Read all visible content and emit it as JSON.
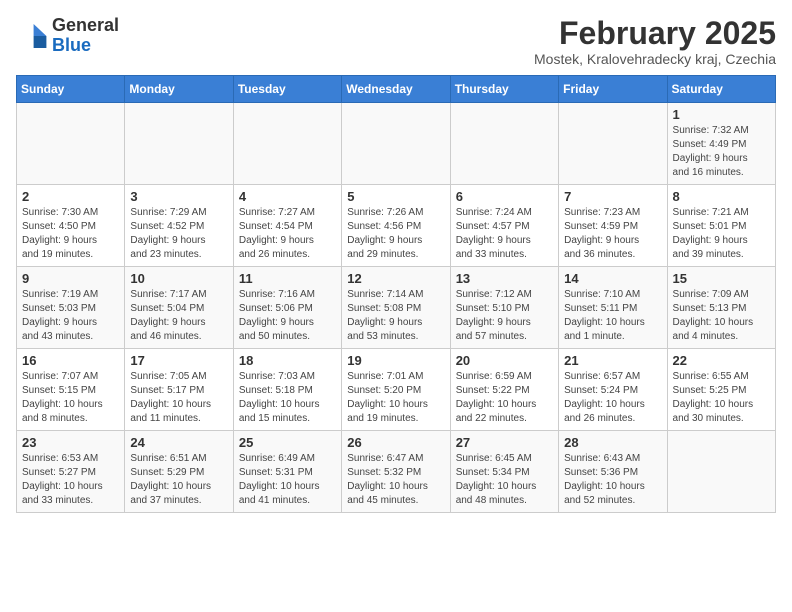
{
  "header": {
    "logo_line1": "General",
    "logo_line2": "Blue",
    "month_year": "February 2025",
    "location": "Mostek, Kralovehradecky kraj, Czechia"
  },
  "weekdays": [
    "Sunday",
    "Monday",
    "Tuesday",
    "Wednesday",
    "Thursday",
    "Friday",
    "Saturday"
  ],
  "weeks": [
    [
      {
        "day": "",
        "info": ""
      },
      {
        "day": "",
        "info": ""
      },
      {
        "day": "",
        "info": ""
      },
      {
        "day": "",
        "info": ""
      },
      {
        "day": "",
        "info": ""
      },
      {
        "day": "",
        "info": ""
      },
      {
        "day": "1",
        "info": "Sunrise: 7:32 AM\nSunset: 4:49 PM\nDaylight: 9 hours\nand 16 minutes."
      }
    ],
    [
      {
        "day": "2",
        "info": "Sunrise: 7:30 AM\nSunset: 4:50 PM\nDaylight: 9 hours\nand 19 minutes."
      },
      {
        "day": "3",
        "info": "Sunrise: 7:29 AM\nSunset: 4:52 PM\nDaylight: 9 hours\nand 23 minutes."
      },
      {
        "day": "4",
        "info": "Sunrise: 7:27 AM\nSunset: 4:54 PM\nDaylight: 9 hours\nand 26 minutes."
      },
      {
        "day": "5",
        "info": "Sunrise: 7:26 AM\nSunset: 4:56 PM\nDaylight: 9 hours\nand 29 minutes."
      },
      {
        "day": "6",
        "info": "Sunrise: 7:24 AM\nSunset: 4:57 PM\nDaylight: 9 hours\nand 33 minutes."
      },
      {
        "day": "7",
        "info": "Sunrise: 7:23 AM\nSunset: 4:59 PM\nDaylight: 9 hours\nand 36 minutes."
      },
      {
        "day": "8",
        "info": "Sunrise: 7:21 AM\nSunset: 5:01 PM\nDaylight: 9 hours\nand 39 minutes."
      }
    ],
    [
      {
        "day": "9",
        "info": "Sunrise: 7:19 AM\nSunset: 5:03 PM\nDaylight: 9 hours\nand 43 minutes."
      },
      {
        "day": "10",
        "info": "Sunrise: 7:17 AM\nSunset: 5:04 PM\nDaylight: 9 hours\nand 46 minutes."
      },
      {
        "day": "11",
        "info": "Sunrise: 7:16 AM\nSunset: 5:06 PM\nDaylight: 9 hours\nand 50 minutes."
      },
      {
        "day": "12",
        "info": "Sunrise: 7:14 AM\nSunset: 5:08 PM\nDaylight: 9 hours\nand 53 minutes."
      },
      {
        "day": "13",
        "info": "Sunrise: 7:12 AM\nSunset: 5:10 PM\nDaylight: 9 hours\nand 57 minutes."
      },
      {
        "day": "14",
        "info": "Sunrise: 7:10 AM\nSunset: 5:11 PM\nDaylight: 10 hours\nand 1 minute."
      },
      {
        "day": "15",
        "info": "Sunrise: 7:09 AM\nSunset: 5:13 PM\nDaylight: 10 hours\nand 4 minutes."
      }
    ],
    [
      {
        "day": "16",
        "info": "Sunrise: 7:07 AM\nSunset: 5:15 PM\nDaylight: 10 hours\nand 8 minutes."
      },
      {
        "day": "17",
        "info": "Sunrise: 7:05 AM\nSunset: 5:17 PM\nDaylight: 10 hours\nand 11 minutes."
      },
      {
        "day": "18",
        "info": "Sunrise: 7:03 AM\nSunset: 5:18 PM\nDaylight: 10 hours\nand 15 minutes."
      },
      {
        "day": "19",
        "info": "Sunrise: 7:01 AM\nSunset: 5:20 PM\nDaylight: 10 hours\nand 19 minutes."
      },
      {
        "day": "20",
        "info": "Sunrise: 6:59 AM\nSunset: 5:22 PM\nDaylight: 10 hours\nand 22 minutes."
      },
      {
        "day": "21",
        "info": "Sunrise: 6:57 AM\nSunset: 5:24 PM\nDaylight: 10 hours\nand 26 minutes."
      },
      {
        "day": "22",
        "info": "Sunrise: 6:55 AM\nSunset: 5:25 PM\nDaylight: 10 hours\nand 30 minutes."
      }
    ],
    [
      {
        "day": "23",
        "info": "Sunrise: 6:53 AM\nSunset: 5:27 PM\nDaylight: 10 hours\nand 33 minutes."
      },
      {
        "day": "24",
        "info": "Sunrise: 6:51 AM\nSunset: 5:29 PM\nDaylight: 10 hours\nand 37 minutes."
      },
      {
        "day": "25",
        "info": "Sunrise: 6:49 AM\nSunset: 5:31 PM\nDaylight: 10 hours\nand 41 minutes."
      },
      {
        "day": "26",
        "info": "Sunrise: 6:47 AM\nSunset: 5:32 PM\nDaylight: 10 hours\nand 45 minutes."
      },
      {
        "day": "27",
        "info": "Sunrise: 6:45 AM\nSunset: 5:34 PM\nDaylight: 10 hours\nand 48 minutes."
      },
      {
        "day": "28",
        "info": "Sunrise: 6:43 AM\nSunset: 5:36 PM\nDaylight: 10 hours\nand 52 minutes."
      },
      {
        "day": "",
        "info": ""
      }
    ]
  ]
}
